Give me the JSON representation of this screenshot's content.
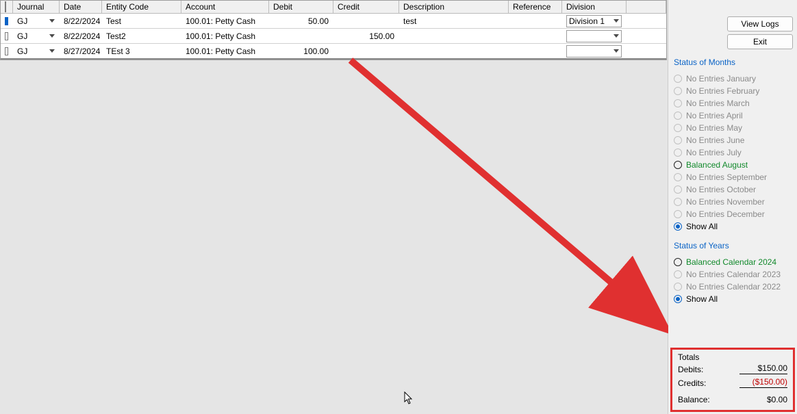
{
  "columns": {
    "journal": "Journal",
    "date": "Date",
    "entity": "Entity Code",
    "account": "Account",
    "debit": "Debit",
    "credit": "Credit",
    "description": "Description",
    "reference": "Reference",
    "division": "Division"
  },
  "rows": [
    {
      "selected": true,
      "journal": "GJ",
      "date": "8/22/2024",
      "entity": "Test",
      "account": "100.01: Petty Cash",
      "debit": "50.00",
      "credit": "",
      "description": "test",
      "reference": "",
      "division": "Division 1"
    },
    {
      "selected": false,
      "journal": "GJ",
      "date": "8/22/2024",
      "entity": "Test2",
      "account": "100.01: Petty Cash",
      "debit": "",
      "credit": "150.00",
      "description": "",
      "reference": "",
      "division": ""
    },
    {
      "selected": false,
      "journal": "GJ",
      "date": "8/27/2024",
      "entity": "TEst 3",
      "account": "100.01: Petty Cash",
      "debit": "100.00",
      "credit": "",
      "description": "",
      "reference": "",
      "division": ""
    }
  ],
  "buttons": {
    "view_logs": "View Logs",
    "exit": "Exit"
  },
  "months": {
    "title": "Status of Months",
    "items": [
      {
        "label": "No Entries January",
        "style": "dim"
      },
      {
        "label": "No Entries February",
        "style": "dim"
      },
      {
        "label": "No Entries March",
        "style": "dim"
      },
      {
        "label": "No Entries April",
        "style": "dim"
      },
      {
        "label": "No Entries May",
        "style": "dim"
      },
      {
        "label": "No Entries June",
        "style": "dim"
      },
      {
        "label": "No Entries July",
        "style": "dim"
      },
      {
        "label": "Balanced August",
        "style": "green"
      },
      {
        "label": "No Entries September",
        "style": "dim"
      },
      {
        "label": "No Entries October",
        "style": "dim"
      },
      {
        "label": "No Entries November",
        "style": "dim"
      },
      {
        "label": "No Entries December",
        "style": "dim"
      },
      {
        "label": "Show All",
        "style": "selected"
      }
    ]
  },
  "years": {
    "title": "Status of Years",
    "items": [
      {
        "label": "Balanced Calendar 2024",
        "style": "green"
      },
      {
        "label": "No Entries Calendar 2023",
        "style": "dim"
      },
      {
        "label": "No Entries Calendar 2022",
        "style": "dim"
      },
      {
        "label": "Show All",
        "style": "selected"
      }
    ]
  },
  "totals": {
    "heading": "Totals",
    "debits_label": "Debits:",
    "debits_value": "$150.00",
    "credits_label": "Credits:",
    "credits_value": "($150.00)",
    "balance_label": "Balance:",
    "balance_value": "$0.00"
  }
}
